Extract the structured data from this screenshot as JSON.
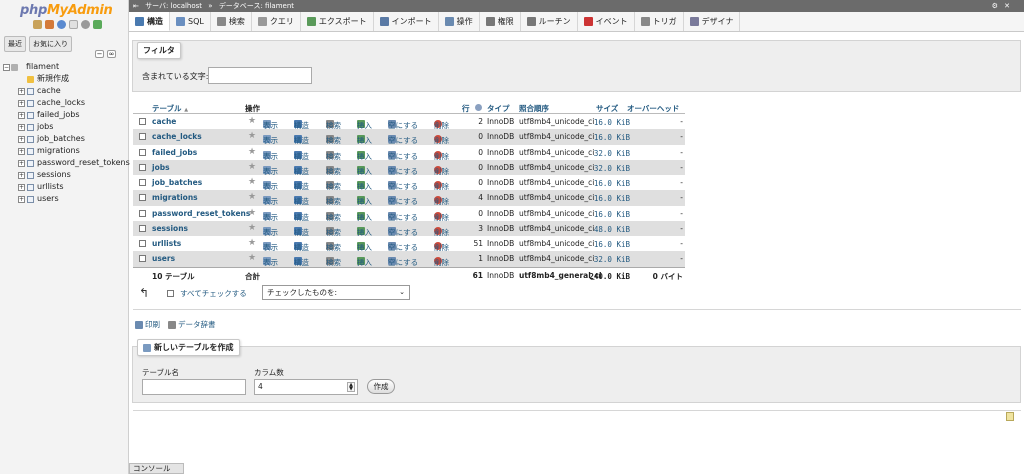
{
  "app": {
    "logo_part1": "php",
    "logo_part2": "MyAdmin"
  },
  "sidebar": {
    "tabs": [
      "最近",
      "お気に入り"
    ],
    "database": "filament",
    "new_item": "新規作成",
    "tables": [
      "cache",
      "cache_locks",
      "failed_jobs",
      "jobs",
      "job_batches",
      "migrations",
      "password_reset_tokens",
      "sessions",
      "urllists",
      "users"
    ]
  },
  "breadcrumb": {
    "server": "サーバ: localhost",
    "separator": "»",
    "database": "データベース: filament"
  },
  "tabs": [
    {
      "label": "構造",
      "icon": "structure-icon",
      "color": "#4a7ab0"
    },
    {
      "label": "SQL",
      "icon": "sql-icon",
      "color": "#6a8fc0"
    },
    {
      "label": "検索",
      "icon": "search-icon",
      "color": "#888888"
    },
    {
      "label": "クエリ",
      "icon": "query-icon",
      "color": "#999999"
    },
    {
      "label": "エクスポート",
      "icon": "export-icon",
      "color": "#5a9a5a"
    },
    {
      "label": "インポート",
      "icon": "import-icon",
      "color": "#5a7aa5"
    },
    {
      "label": "操作",
      "icon": "wrench-icon",
      "color": "#6a8ab0"
    },
    {
      "label": "権限",
      "icon": "privileges-icon",
      "color": "#777777"
    },
    {
      "label": "ルーチン",
      "icon": "routines-icon",
      "color": "#777777"
    },
    {
      "label": "イベント",
      "icon": "events-icon",
      "color": "#cc3333"
    },
    {
      "label": "トリガ",
      "icon": "triggers-icon",
      "color": "#888888"
    },
    {
      "label": "デザイナ",
      "icon": "designer-icon",
      "color": "#7a7a9a"
    }
  ],
  "filter": {
    "legend": "フィルタ",
    "label": "含まれている文字:",
    "value": ""
  },
  "table_header": {
    "table": "テーブル",
    "sort_arrow": "▲",
    "action": "操作",
    "rows": "行",
    "type": "タイプ",
    "collation": "照合順序",
    "size": "サイズ",
    "overhead": "オーバーヘッド"
  },
  "actions": {
    "browse": "表示",
    "structure": "構造",
    "search": "検索",
    "insert": "挿入",
    "empty": "空にする",
    "drop": "削除"
  },
  "rows": [
    {
      "name": "cache",
      "rows": "2",
      "type": "InnoDB",
      "collation": "utf8mb4_unicode_ci",
      "size": "16.0 KiB",
      "overhead": "-"
    },
    {
      "name": "cache_locks",
      "rows": "0",
      "type": "InnoDB",
      "collation": "utf8mb4_unicode_ci",
      "size": "16.0 KiB",
      "overhead": "-"
    },
    {
      "name": "failed_jobs",
      "rows": "0",
      "type": "InnoDB",
      "collation": "utf8mb4_unicode_ci",
      "size": "32.0 KiB",
      "overhead": "-"
    },
    {
      "name": "jobs",
      "rows": "0",
      "type": "InnoDB",
      "collation": "utf8mb4_unicode_ci",
      "size": "32.0 KiB",
      "overhead": "-"
    },
    {
      "name": "job_batches",
      "rows": "0",
      "type": "InnoDB",
      "collation": "utf8mb4_unicode_ci",
      "size": "16.0 KiB",
      "overhead": "-"
    },
    {
      "name": "migrations",
      "rows": "4",
      "type": "InnoDB",
      "collation": "utf8mb4_unicode_ci",
      "size": "16.0 KiB",
      "overhead": "-"
    },
    {
      "name": "password_reset_tokens",
      "rows": "0",
      "type": "InnoDB",
      "collation": "utf8mb4_unicode_ci",
      "size": "16.0 KiB",
      "overhead": "-"
    },
    {
      "name": "sessions",
      "rows": "3",
      "type": "InnoDB",
      "collation": "utf8mb4_unicode_ci",
      "size": "48.0 KiB",
      "overhead": "-"
    },
    {
      "name": "urllists",
      "rows": "51",
      "type": "InnoDB",
      "collation": "utf8mb4_unicode_ci",
      "size": "16.0 KiB",
      "overhead": "-"
    },
    {
      "name": "users",
      "rows": "1",
      "type": "InnoDB",
      "collation": "utf8mb4_unicode_ci",
      "size": "32.0 KiB",
      "overhead": "-"
    }
  ],
  "summary": {
    "count": "10 テーブル",
    "label": "合計",
    "rows": "61",
    "type": "InnoDB",
    "collation": "utf8mb4_general_ci",
    "size": "240.0 KiB",
    "overhead": "0 バイト"
  },
  "bulk": {
    "check_all": "すべてチェックする",
    "select_value": "チェックしたものを:"
  },
  "links": {
    "print": "印刷",
    "dictionary": "データ辞書"
  },
  "create": {
    "legend": "新しいテーブルを作成",
    "name_label": "テーブル名",
    "columns_label": "カラム数",
    "columns_value": "4",
    "go": "作成"
  },
  "console": "コンソール"
}
